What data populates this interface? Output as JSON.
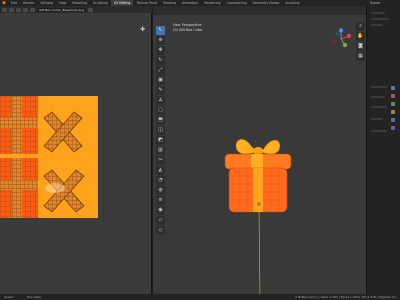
{
  "menu": {
    "tabs": [
      "Edit",
      "Render",
      "Window",
      "Help",
      "Modeling",
      "Sculpting",
      "UV Editing",
      "Texture Paint",
      "Shading",
      "Animation",
      "Rendering",
      "Compositing",
      "Geometry Nodes",
      "Scripting"
    ],
    "active_tab": "UV Editing",
    "scene_label": "Scene"
  },
  "uv_editor": {
    "image_name": "Gift Box Comic_BaseColor.png"
  },
  "viewport": {
    "view_label": "User Perspective",
    "object_label": "(0) Gift Box Cube"
  },
  "status_bar": {
    "left": "Select",
    "middle": "Pan View",
    "right": "Gift Box Comic | Verts 1,184 | Faces 1,200 | Tris 2,376 | Objects 1/1"
  },
  "colors": {
    "accent": "#4772b3",
    "box_orange": "#ff6a1f",
    "ribbon_yellow": "#ffb020",
    "uv_background": "#ffa21e",
    "uv_red": "#ff5a12",
    "uv_brown": "#a0521b"
  }
}
